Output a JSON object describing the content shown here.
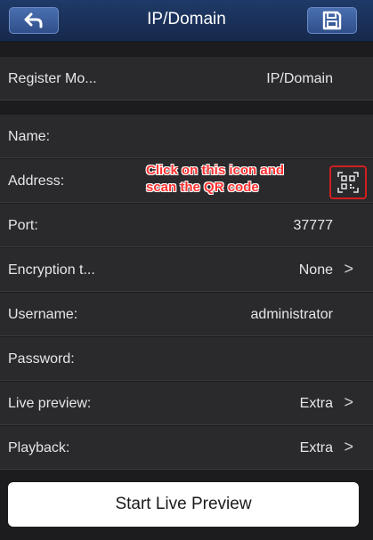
{
  "header": {
    "title": "IP/Domain",
    "back_icon": "back-arrow-icon",
    "save_icon": "save-floppy-icon",
    "background": "#1f3a68"
  },
  "register_mode": {
    "label": "Register Mo...",
    "value": "IP/Domain"
  },
  "fields": [
    {
      "label": "Name:",
      "value": ""
    },
    {
      "label": "Address:",
      "value": "",
      "icon": "qr-scan-icon"
    },
    {
      "label": "Port:",
      "value": "37777"
    },
    {
      "label": "Encryption t...",
      "value": "None",
      "chevron": true
    },
    {
      "label": "Username:",
      "value": "administrator"
    },
    {
      "label": "Password:",
      "value": ""
    },
    {
      "label": "Live preview:",
      "value": "Extra",
      "chevron": true
    },
    {
      "label": "Playback:",
      "value": "Extra",
      "chevron": true
    }
  ],
  "annotation": {
    "line1": "Click on this icon and",
    "line2": "scan the QR code",
    "color": "#ff3030"
  },
  "chevron_glyph": ">",
  "start_button": {
    "label": "Start Live Preview"
  }
}
